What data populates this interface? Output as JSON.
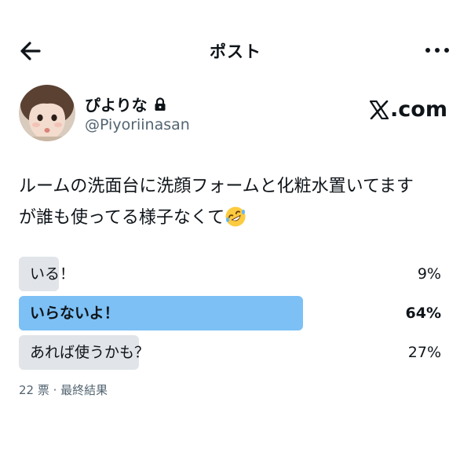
{
  "header": {
    "title": "ポスト",
    "back_icon": "arrow-left-icon",
    "more_icon": "more-horizontal-icon"
  },
  "author": {
    "display_name": "ぴよりな",
    "lock_icon": "lock-icon",
    "handle": "@Piyoriinasan"
  },
  "brand": {
    "logo_icon": "x-logo-icon",
    "domain_text": ".com"
  },
  "post": {
    "text_line1": "ルームの洗面台に洗顔フォームと化粧水置いてます",
    "text_line2": "が誰も使ってる様子なくて",
    "emoji_icon": "rolling-on-floor-laughing-emoji"
  },
  "poll": {
    "options": [
      {
        "label": "いる！",
        "percent_text": "9%",
        "percent": 9,
        "winner": false
      },
      {
        "label": "いらないよ！",
        "percent_text": "64%",
        "percent": 64,
        "winner": true
      },
      {
        "label": "あれば使うかも？",
        "percent_text": "27%",
        "percent": 27,
        "winner": false
      }
    ],
    "meta": "22 票 · 最終結果"
  },
  "colors": {
    "winner_bar": "#7cc0f5",
    "bar": "#e1e4e8",
    "secondary_text": "#536471",
    "text": "#0f1419"
  }
}
